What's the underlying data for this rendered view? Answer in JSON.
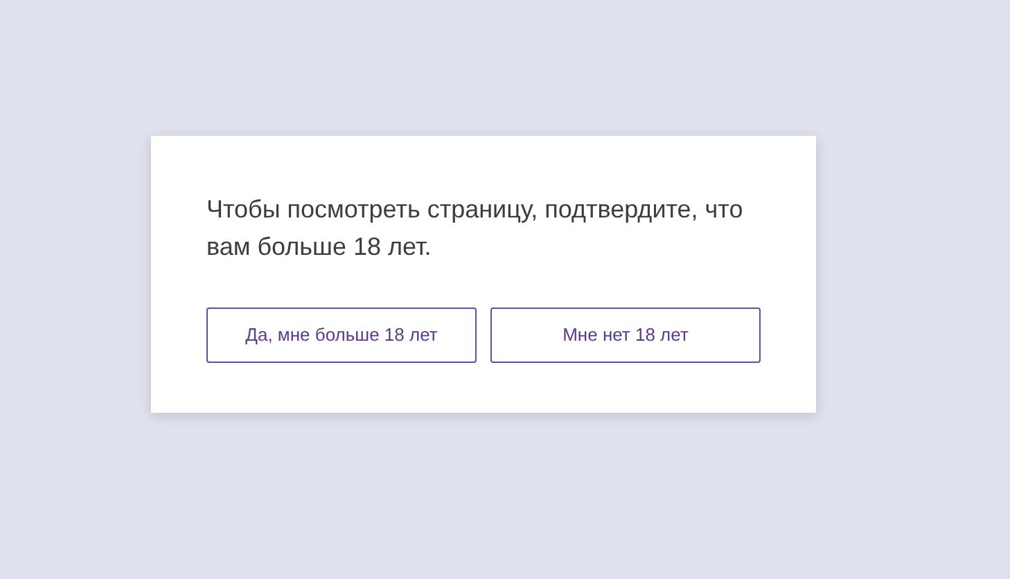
{
  "dialog": {
    "message": "Чтобы посмотреть страницу, подтвердите, что вам больше 18 лет.",
    "buttons": [
      {
        "label": "Да, мне больше 18 лет"
      },
      {
        "label": "Мне нет 18 лет"
      }
    ]
  }
}
